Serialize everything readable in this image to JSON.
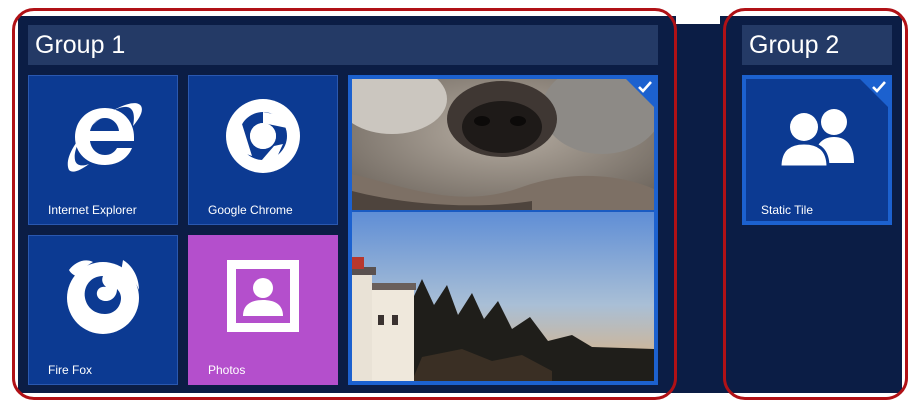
{
  "groups": [
    {
      "title": "Group 1"
    },
    {
      "title": "Group 2"
    }
  ],
  "tiles": {
    "ie": {
      "label": "Internet Explorer",
      "icon": "internet-explorer-icon"
    },
    "chrome": {
      "label": "Google Chrome",
      "icon": "chrome-icon"
    },
    "firefox": {
      "label": "Fire Fox",
      "icon": "firefox-icon"
    },
    "photos": {
      "label": "Photos",
      "icon": "photo-frame-icon"
    },
    "slideshow": {
      "label": "",
      "icon": "koala-and-lighthouse-photos",
      "selected": true
    },
    "static": {
      "label": "Static Tile",
      "icon": "people-icon",
      "selected": true
    }
  },
  "colors": {
    "tile_blue": "#0c3a92",
    "photos_purple": "#b44fcc",
    "selection_blue": "#1c61cf",
    "group_outline_red": "#b01116",
    "header_bg": "#243a66",
    "panel_bg": "#0b1d45"
  }
}
